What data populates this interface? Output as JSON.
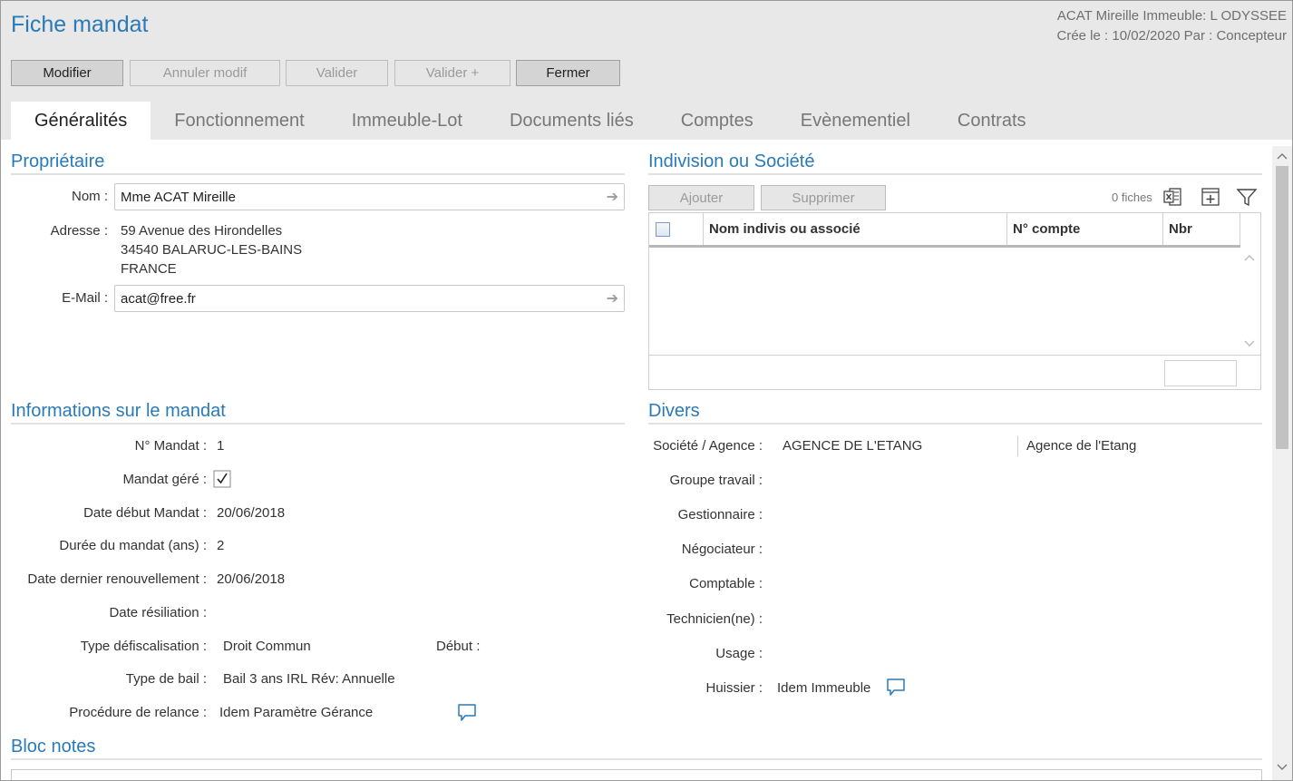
{
  "header": {
    "title": "Fiche mandat",
    "info_line1": "ACAT Mireille Immeuble: L ODYSSEE",
    "info_line2": "Crée le : 10/02/2020 Par : Concepteur"
  },
  "toolbar": {
    "modifier": "Modifier",
    "annuler": "Annuler modif",
    "valider": "Valider",
    "valider_plus": "Valider +",
    "fermer": "Fermer"
  },
  "tabs": [
    "Généralités",
    "Fonctionnement",
    "Immeuble-Lot",
    "Documents liés",
    "Comptes",
    "Evènementiel",
    "Contrats"
  ],
  "proprietaire": {
    "title": "Propriétaire",
    "nom_label": "Nom :",
    "nom_value": "Mme ACAT Mireille",
    "adresse_label": "Adresse :",
    "adresse_line1": "59 Avenue des Hirondelles",
    "adresse_line2": "34540 BALARUC-LES-BAINS",
    "adresse_line3": "FRANCE",
    "email_label": "E-Mail :",
    "email_value": "acat@free.fr"
  },
  "indivision": {
    "title": "Indivision ou Société",
    "ajouter": "Ajouter",
    "supprimer": "Supprimer",
    "count": "0 fiches",
    "columns": [
      "Nom indivis ou associé",
      "N° compte",
      "Nbr"
    ]
  },
  "mandat": {
    "title": "Informations sur le mandat",
    "fields": [
      {
        "label": "N° Mandat :",
        "value": "1"
      },
      {
        "label": "Mandat géré :",
        "value": ""
      },
      {
        "label": "Date début Mandat :",
        "value": "20/06/2018"
      },
      {
        "label": "Durée du mandat (ans) :",
        "value": "2"
      },
      {
        "label": "Date dernier renouvellement :",
        "value": "20/06/2018"
      },
      {
        "label": "Date résiliation :",
        "value": ""
      },
      {
        "label": "Type défiscalisation :",
        "value": "Droit Commun"
      },
      {
        "label": "Type de bail :",
        "value": "Bail 3 ans IRL Rév: Annuelle"
      },
      {
        "label": "Procédure de relance :",
        "value": "Idem Paramètre Gérance"
      }
    ],
    "debut_label": "Début :",
    "mandat_gere_checked": true
  },
  "divers": {
    "title": "Divers",
    "fields": [
      {
        "label": "Société / Agence :",
        "value": "AGENCE DE L'ETANG",
        "extra": "Agence de l'Etang"
      },
      {
        "label": "Groupe travail :",
        "value": ""
      },
      {
        "label": "Gestionnaire :",
        "value": ""
      },
      {
        "label": "Négociateur :",
        "value": ""
      },
      {
        "label": "Comptable :",
        "value": ""
      },
      {
        "label": "Technicien(ne) :",
        "value": ""
      },
      {
        "label": "Usage :",
        "value": ""
      },
      {
        "label": "Huissier :",
        "value": "Idem Immeuble"
      }
    ]
  },
  "bloc_notes": {
    "title": "Bloc notes"
  },
  "colors": {
    "accent": "#2a7ab8",
    "header_bg": "#e8e8e8"
  }
}
